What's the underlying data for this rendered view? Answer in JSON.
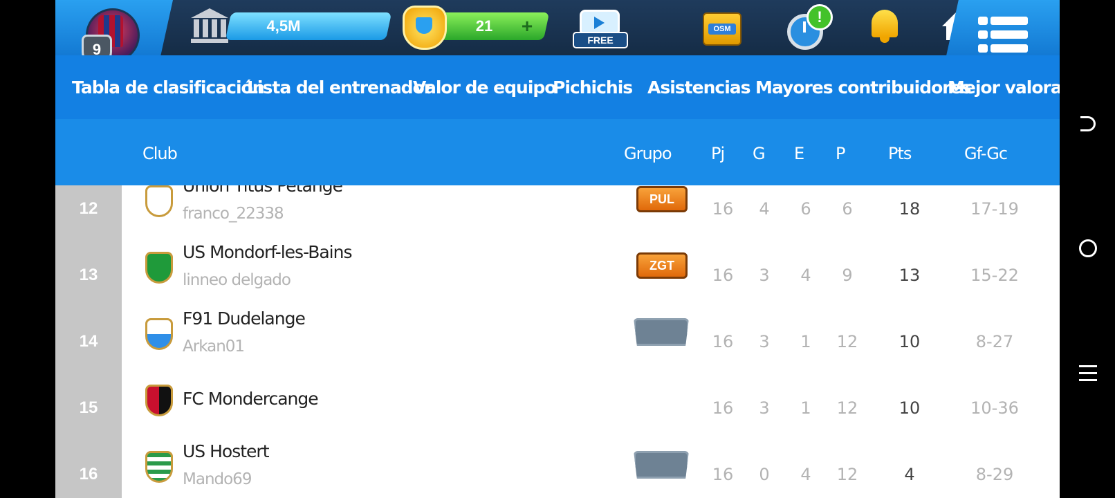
{
  "topbar": {
    "level": "9",
    "money": "4,5M",
    "coins": "21",
    "free_label": "FREE",
    "osm_label": "OSM",
    "alert": "!"
  },
  "tabs": [
    {
      "label": "Tabla de clasificación"
    },
    {
      "label": "Lista del entrenador"
    },
    {
      "label": "Valor de equipo"
    },
    {
      "label": "Pichichis"
    },
    {
      "label": "Asistencias"
    },
    {
      "label": "Mayores contribuidores"
    },
    {
      "label": "Mejor valorac"
    }
  ],
  "table": {
    "headers": {
      "club": "Club",
      "group": "Grupo",
      "pj": "Pj",
      "g": "G",
      "e": "E",
      "p": "P",
      "pts": "Pts",
      "gfgc": "Gf-Gc"
    },
    "rows": [
      {
        "rank": "12",
        "club": "Union Titus Pétange",
        "manager": "franco_22338",
        "group": "PUL",
        "pj": "16",
        "g": "4",
        "e": "6",
        "p": "6",
        "pts": "18",
        "gfgc": "17-19",
        "crest_color": "#ffffff"
      },
      {
        "rank": "13",
        "club": "US Mondorf-les-Bains",
        "manager": "linneo delgado",
        "group": "ZGT",
        "pj": "16",
        "g": "3",
        "e": "4",
        "p": "9",
        "pts": "13",
        "gfgc": "15-22",
        "crest_color": "#1f9a3a"
      },
      {
        "rank": "14",
        "club": "F91 Dudelange",
        "manager": "Arkan01",
        "group": "",
        "pj": "16",
        "g": "3",
        "e": "1",
        "p": "12",
        "pts": "10",
        "gfgc": "8-27",
        "crest_color": "#2f8fe8"
      },
      {
        "rank": "15",
        "club": "FC Mondercange",
        "manager": "",
        "group": "",
        "pj": "16",
        "g": "3",
        "e": "1",
        "p": "12",
        "pts": "10",
        "gfgc": "10-36",
        "crest_color": "#c8102e"
      },
      {
        "rank": "16",
        "club": "US Hostert",
        "manager": "Mando69",
        "group": "",
        "pj": "16",
        "g": "0",
        "e": "4",
        "p": "12",
        "pts": "4",
        "gfgc": "8-29",
        "crest_color": "#2a9a4a"
      }
    ]
  },
  "navbar": {
    "back": "back-icon",
    "home": "home-circle-icon",
    "menu": "menu-lines-icon"
  }
}
